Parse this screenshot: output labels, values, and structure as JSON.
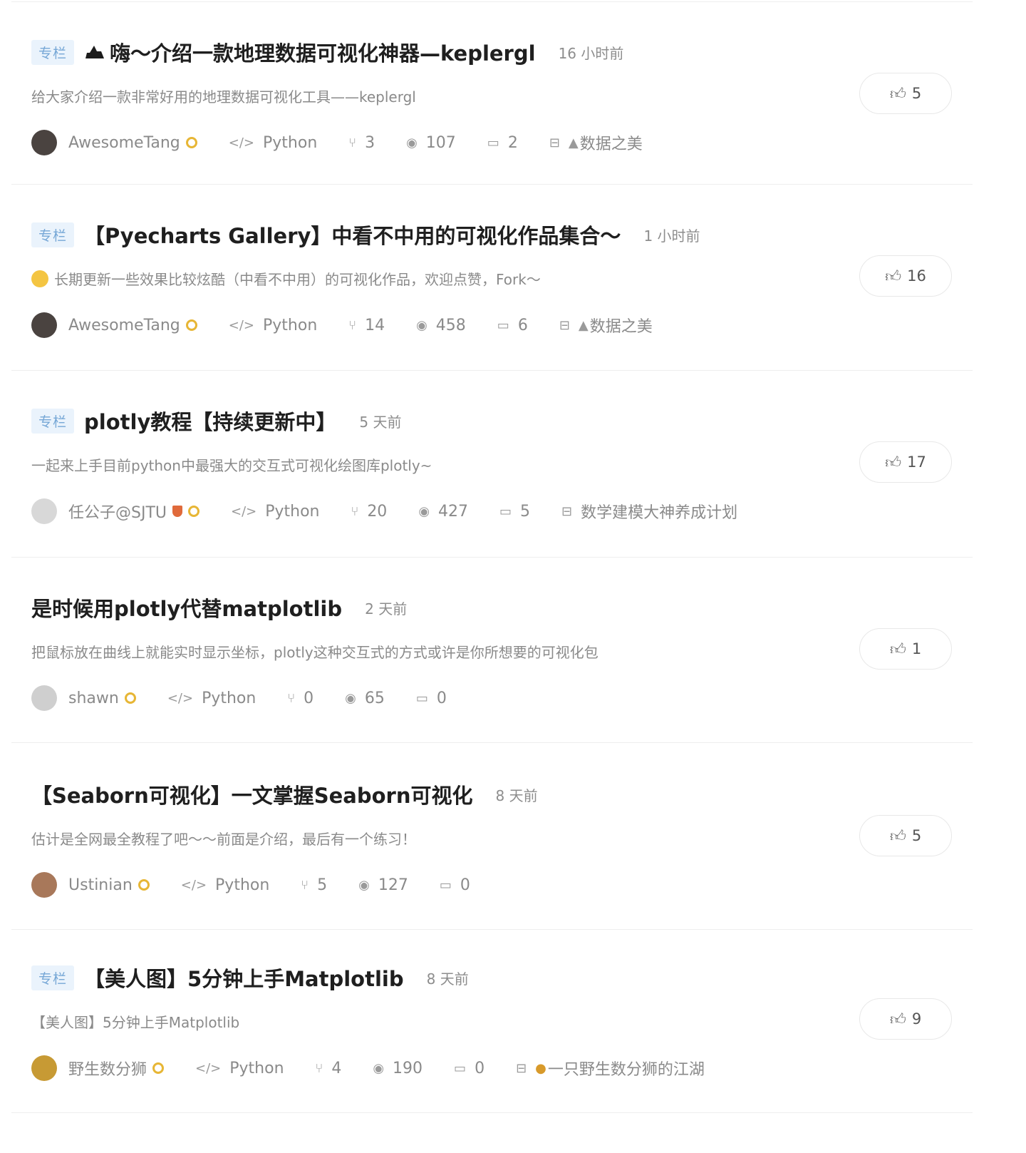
{
  "items": [
    {
      "badge": "专栏",
      "title": "嗨～介绍一款地理数据可视化神器—keplergl",
      "time": "16 小时前",
      "desc": "给大家介绍一款非常好用的地理数据可视化工具——keplergl",
      "author": "AwesomeTang",
      "tag": "Python",
      "forks": "3",
      "views": "107",
      "comments": "2",
      "column": "数据之美",
      "likes": "5"
    },
    {
      "badge": "专栏",
      "title": "【Pyecharts Gallery】中看不中用的可视化作品集合～",
      "time": "1 小时前",
      "desc": "长期更新一些效果比较炫酷（中看不中用）的可视化作品，欢迎点赞，Fork～",
      "author": "AwesomeTang",
      "tag": "Python",
      "forks": "14",
      "views": "458",
      "comments": "6",
      "column": "数据之美",
      "likes": "16"
    },
    {
      "badge": "专栏",
      "title": "plotly教程【持续更新中】",
      "time": "5 天前",
      "desc": "一起来上手目前python中最强大的交互式可视化绘图库plotly~",
      "author": "任公子@SJTU",
      "tag": "Python",
      "forks": "20",
      "views": "427",
      "comments": "5",
      "column": "数学建模大神养成计划",
      "likes": "17"
    },
    {
      "title": "是时候用plotly代替matplotlib",
      "time": "2 天前",
      "desc": "把鼠标放在曲线上就能实时显示坐标，plotly这种交互式的方式或许是你所想要的可视化包",
      "author": "shawn",
      "tag": "Python",
      "forks": "0",
      "views": "65",
      "comments": "0",
      "likes": "1"
    },
    {
      "title": "【Seaborn可视化】一文掌握Seaborn可视化",
      "time": "8 天前",
      "desc": "估计是全网最全教程了吧～～前面是介绍，最后有一个练习！",
      "author": "Ustinian",
      "tag": "Python",
      "forks": "5",
      "views": "127",
      "comments": "0",
      "likes": "5"
    },
    {
      "badge": "专栏",
      "title": "【美人图】5分钟上手Matplotlib",
      "time": "8 天前",
      "desc": "【美人图】5分钟上手Matplotlib",
      "author": "野生数分狮",
      "tag": "Python",
      "forks": "4",
      "views": "190",
      "comments": "0",
      "column": "一只野生数分狮的江湖",
      "likes": "9"
    }
  ]
}
